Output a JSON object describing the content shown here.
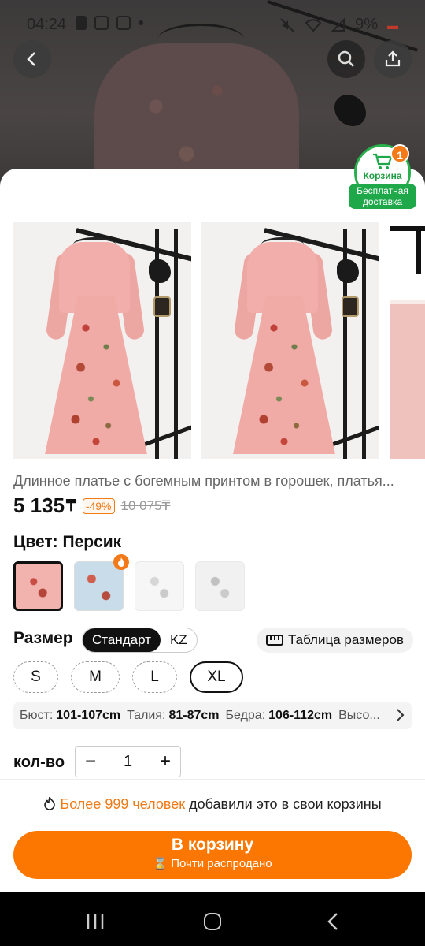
{
  "status_bar": {
    "time": "04:24",
    "battery": "9%"
  },
  "cart_widget": {
    "label": "Корзина",
    "count": "1",
    "free_shipping": "Бесплатная доставка"
  },
  "product": {
    "title": "Длинное платье с богемным принтом в горошек, платья...",
    "price": "5 135",
    "currency": "₸",
    "discount": "-49%",
    "old_price": "10 075₸"
  },
  "color": {
    "label": "Цвет: Персик",
    "options": [
      {
        "name": "Персик",
        "selected": true
      },
      {
        "name": "Голубой",
        "hot": true
      },
      {
        "name": "Белый",
        "available": false
      },
      {
        "name": "Серый",
        "available": false
      }
    ]
  },
  "size": {
    "label": "Размер",
    "systems": [
      "Стандарт",
      "KZ"
    ],
    "active_system": "Стандарт",
    "chart_label": "Таблица размеров",
    "options": [
      "S",
      "M",
      "L",
      "XL"
    ],
    "selected": "XL"
  },
  "measurements": {
    "bust_key": "Бюст:",
    "bust_val": "101-107cm",
    "waist_key": "Талия:",
    "waist_val": "81-87cm",
    "hips_key": "Бедра:",
    "hips_val": "106-112cm",
    "more": "Высо..."
  },
  "quantity": {
    "label": "кол-во",
    "value": "1",
    "minus": "−",
    "plus": "+"
  },
  "social_proof": {
    "highlight": "Более 999 человек",
    "rest": " добавили это в свои корзины"
  },
  "add_to_cart": {
    "label": "В корзину",
    "sub": "Почти распродано"
  },
  "colors": {
    "accent": "#fb7701",
    "green": "#1ea84a"
  }
}
